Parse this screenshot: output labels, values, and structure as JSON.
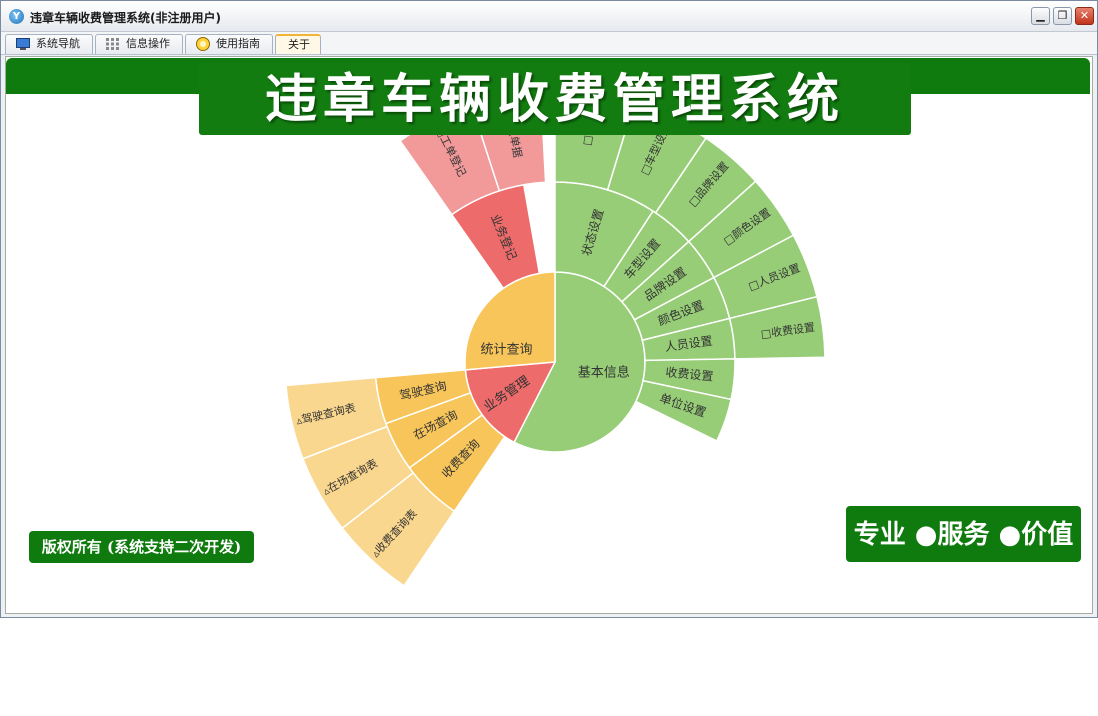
{
  "window": {
    "title": "违章车辆收费管理系统(非注册用户)",
    "min_label": "▁",
    "max_label": "❐",
    "close_label": "✕"
  },
  "tabs": [
    {
      "label": "系统导航",
      "icon": "monitor-icon"
    },
    {
      "label": "信息操作",
      "icon": "grid-icon"
    },
    {
      "label": "使用指南",
      "icon": "help-icon"
    },
    {
      "label": "关于",
      "icon": ""
    }
  ],
  "header": {
    "title": "违章车辆收费管理系统"
  },
  "footer": {
    "copyright": "版权所有 (系统支持二次开发)",
    "slogan": "专业 ●服务 ●价值"
  },
  "colors": {
    "brand_green": "#0f7a0d",
    "basic_info": "#97cd77",
    "business": "#ee6b6b",
    "stats": "#f7c55a"
  },
  "sunburst": {
    "inner": [
      {
        "key": "basic",
        "label": "基本信息"
      },
      {
        "key": "biz",
        "label": "业务管理"
      },
      {
        "key": "stat",
        "label": "统计查询"
      }
    ],
    "middle": [
      {
        "label": "状态设置"
      },
      {
        "label": "车型设置"
      },
      {
        "label": "品牌设置"
      },
      {
        "label": "颜色设置"
      },
      {
        "label": "人员设置"
      },
      {
        "label": "收费设置"
      },
      {
        "label": "单位设置"
      },
      {
        "label": "业务登记"
      },
      {
        "label": "收费查询"
      },
      {
        "label": "在场查询"
      },
      {
        "label": "驾驶查询"
      }
    ],
    "outer": [
      {
        "label": "□状态"
      },
      {
        "label": "□车型设置"
      },
      {
        "label": "□品牌设置"
      },
      {
        "label": "□颜色设置"
      },
      {
        "label": "□人员设置"
      },
      {
        "label": "□收费设置"
      },
      {
        "label": "□工单登记"
      },
      {
        "label": "□收款单据"
      },
      {
        "label": "▵收费查询表"
      },
      {
        "label": "▵在场查询表"
      },
      {
        "label": "▵驾驶查询表"
      }
    ]
  }
}
